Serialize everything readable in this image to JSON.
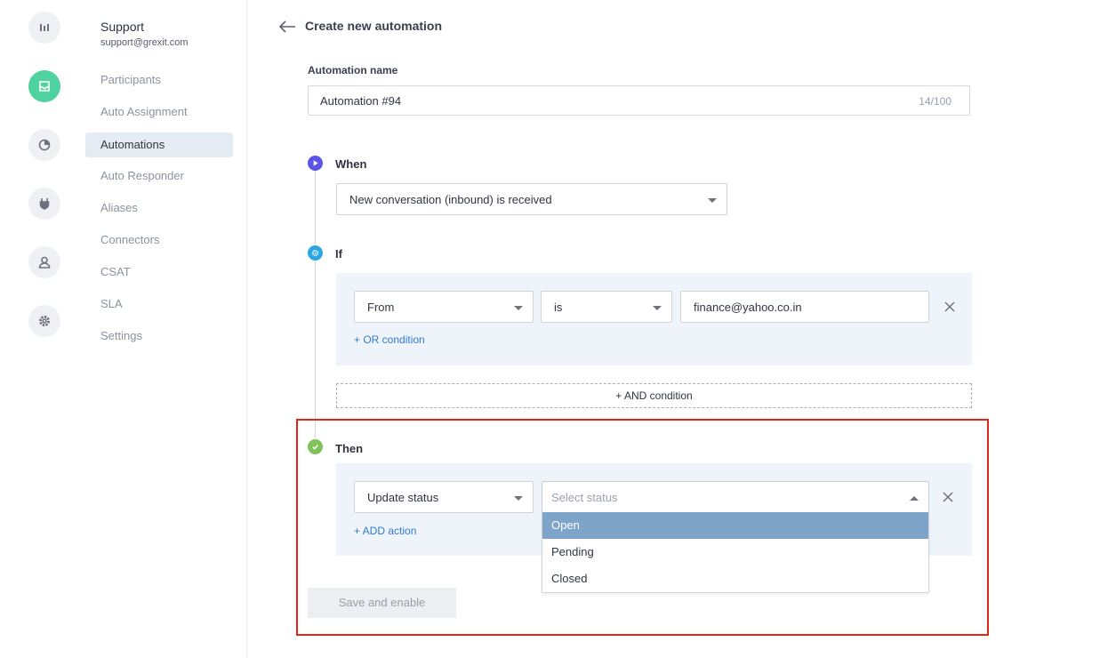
{
  "rail": {
    "icons": [
      "reports-icon",
      "inbox-icon",
      "analytics-icon",
      "plug-icon",
      "user-icon",
      "gear-icon"
    ],
    "active_color": "#4fd1a0"
  },
  "account": {
    "name": "Support",
    "email": "support@grexit.com"
  },
  "nav": {
    "items": [
      {
        "label": "Participants"
      },
      {
        "label": "Auto Assignment"
      },
      {
        "label": "Automations"
      },
      {
        "label": "Auto Responder"
      },
      {
        "label": "Aliases"
      },
      {
        "label": "Connectors"
      },
      {
        "label": "CSAT"
      },
      {
        "label": "SLA"
      },
      {
        "label": "Settings"
      }
    ],
    "active": "Automations"
  },
  "header": {
    "title": "Create new automation"
  },
  "automation_name": {
    "label": "Automation name",
    "value": "Automation #94",
    "counter": "14/100"
  },
  "when": {
    "label": "When",
    "trigger": "New conversation (inbound) is received",
    "color": "#5a55e6"
  },
  "if": {
    "label": "If",
    "color": "#2da7e0",
    "condition": {
      "field": "From",
      "operator": "is",
      "value": "finance@yahoo.co.in"
    },
    "or_link": "+ OR condition",
    "and_button": "+ AND condition"
  },
  "then": {
    "label": "Then",
    "color": "#7ec45a",
    "action": "Update status",
    "status_placeholder": "Select status",
    "status_options": [
      "Open",
      "Pending",
      "Closed"
    ],
    "highlighted_option": "Open",
    "add_action_link": "+ ADD action"
  },
  "save_button": {
    "label": "Save and enable"
  },
  "annotation_color": "#e1251b"
}
